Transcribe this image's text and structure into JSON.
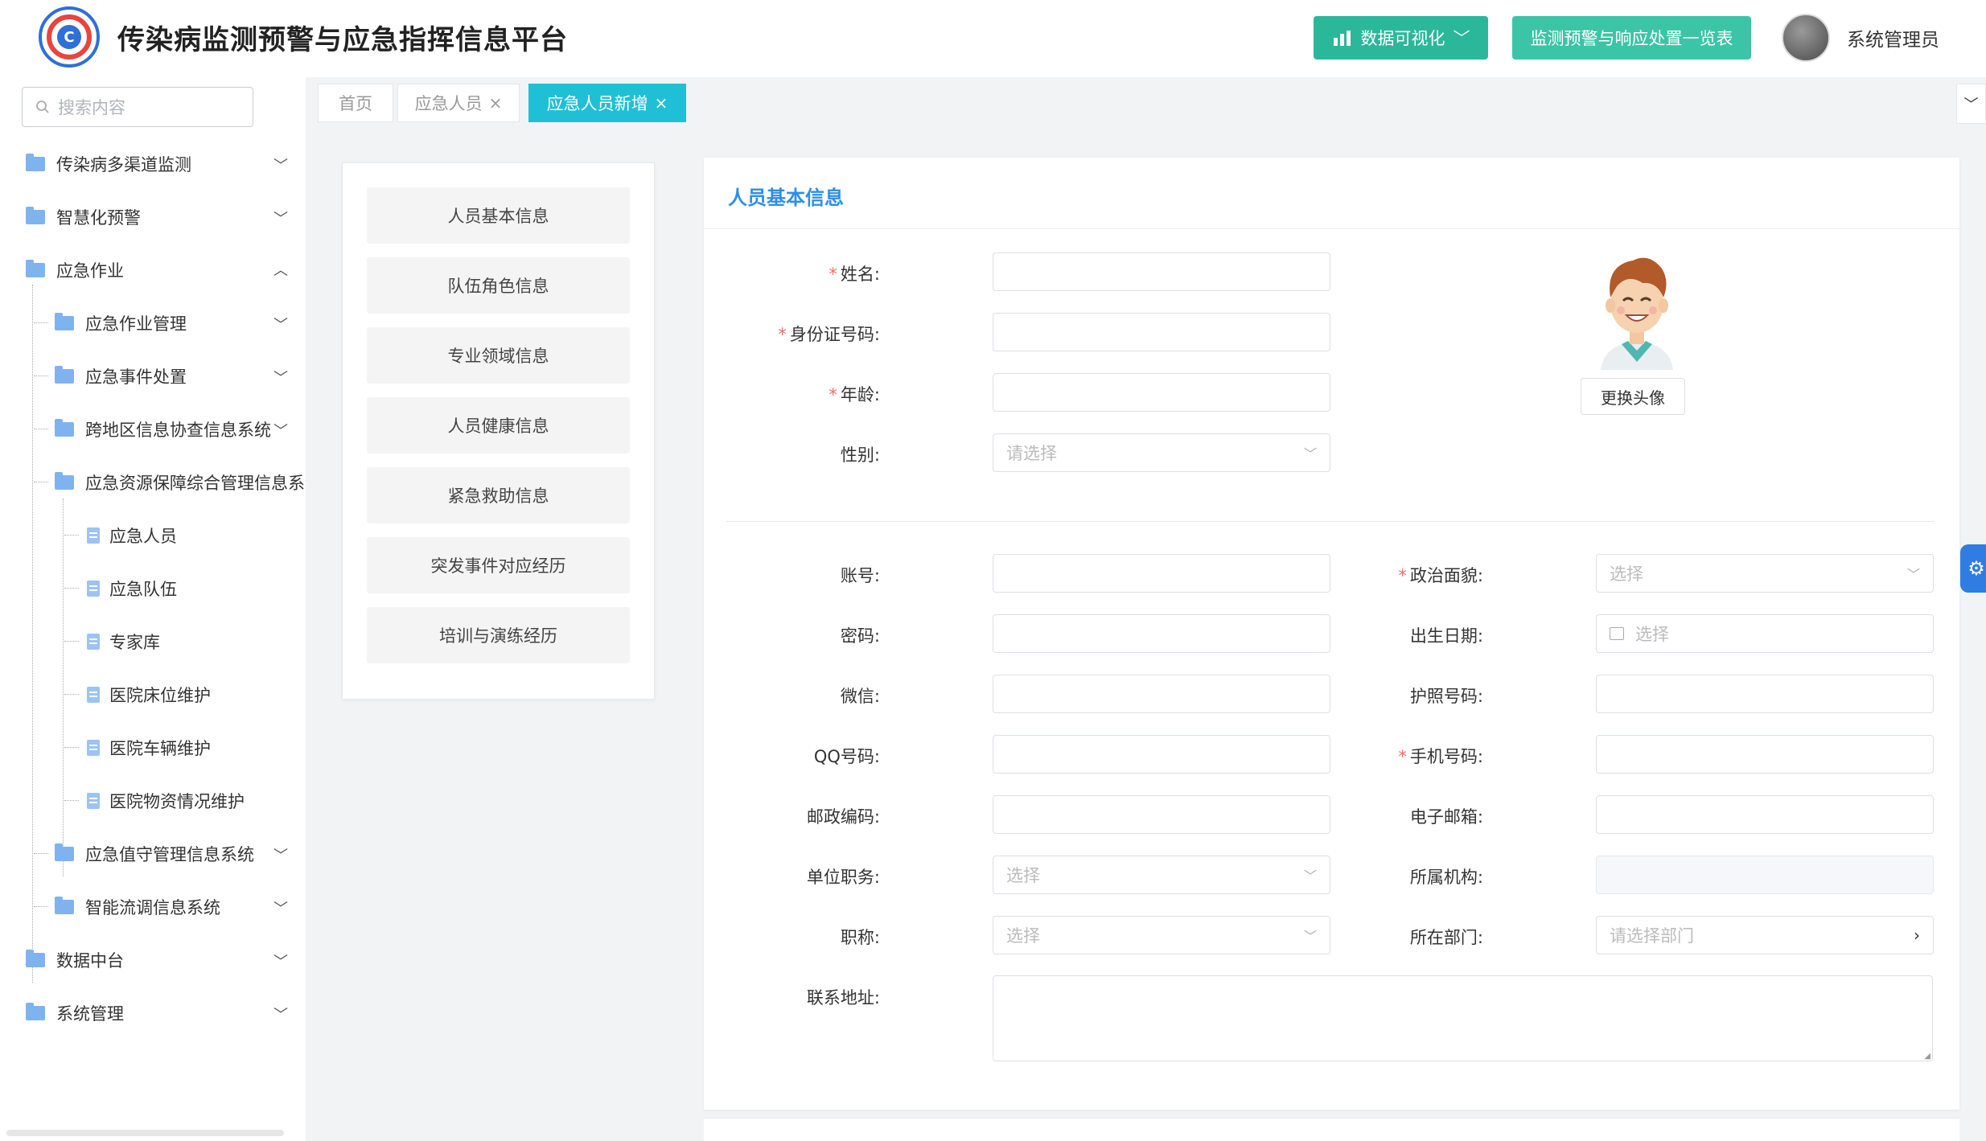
{
  "header": {
    "title": "传染病监测预警与应急指挥信息平台",
    "viz_button": "数据可视化",
    "list_button": "监测预警与响应处置一览表",
    "user_name": "系统管理员"
  },
  "sidebar": {
    "search_placeholder": "搜索内容",
    "items": [
      {
        "label": "传染病多渠道监测"
      },
      {
        "label": "智慧化预警"
      },
      {
        "label": "应急作业"
      },
      {
        "label": "应急作业管理"
      },
      {
        "label": "应急事件处置"
      },
      {
        "label": "跨地区信息协查信息系统"
      },
      {
        "label": "应急资源保障综合管理信息系统"
      },
      {
        "label": "应急人员"
      },
      {
        "label": "应急队伍"
      },
      {
        "label": "专家库"
      },
      {
        "label": "医院床位维护"
      },
      {
        "label": "医院车辆维护"
      },
      {
        "label": "医院物资情况维护"
      },
      {
        "label": "应急值守管理信息系统"
      },
      {
        "label": "智能流调信息系统"
      },
      {
        "label": "数据中台"
      },
      {
        "label": "系统管理"
      }
    ]
  },
  "tabs": [
    {
      "label": "首页"
    },
    {
      "label": "应急人员",
      "close": "×"
    },
    {
      "label": "应急人员新增",
      "close": "×"
    }
  ],
  "section_nav": [
    {
      "label": "人员基本信息"
    },
    {
      "label": "队伍角色信息"
    },
    {
      "label": "专业领域信息"
    },
    {
      "label": "人员健康信息"
    },
    {
      "label": "紧急救助信息"
    },
    {
      "label": "突发事件对应经历"
    },
    {
      "label": "培训与演练经历"
    }
  ],
  "form": {
    "card_title": "人员基本信息",
    "change_avatar": "更换头像",
    "name_label": "姓名:",
    "idcard_label": "身份证号码:",
    "age_label": "年龄:",
    "gender_label": "性别:",
    "gender_placeholder": "请选择",
    "account_label": "账号:",
    "password_label": "密码:",
    "wechat_label": "微信:",
    "qq_label": "QQ号码:",
    "postcode_label": "邮政编码:",
    "position_label": "单位职务:",
    "position_placeholder": "选择",
    "title_label": "职称:",
    "title_placeholder": "选择",
    "politics_label": "政治面貌:",
    "politics_placeholder": "选择",
    "birth_label": "出生日期:",
    "birth_placeholder": "选择",
    "passport_label": "护照号码:",
    "phone_label": "手机号码:",
    "email_label": "电子邮箱:",
    "org_label": "所属机构:",
    "dept_label": "所在部门:",
    "dept_placeholder": "请选择部门",
    "address_label": "联系地址:",
    "required_mark": "*"
  },
  "colors": {
    "accent": "#2e8ee8",
    "active_tab": "#1fc0d6",
    "viz_button": "#2bb79a",
    "list_button": "#3cc4a6",
    "required": "#f56c6c"
  }
}
